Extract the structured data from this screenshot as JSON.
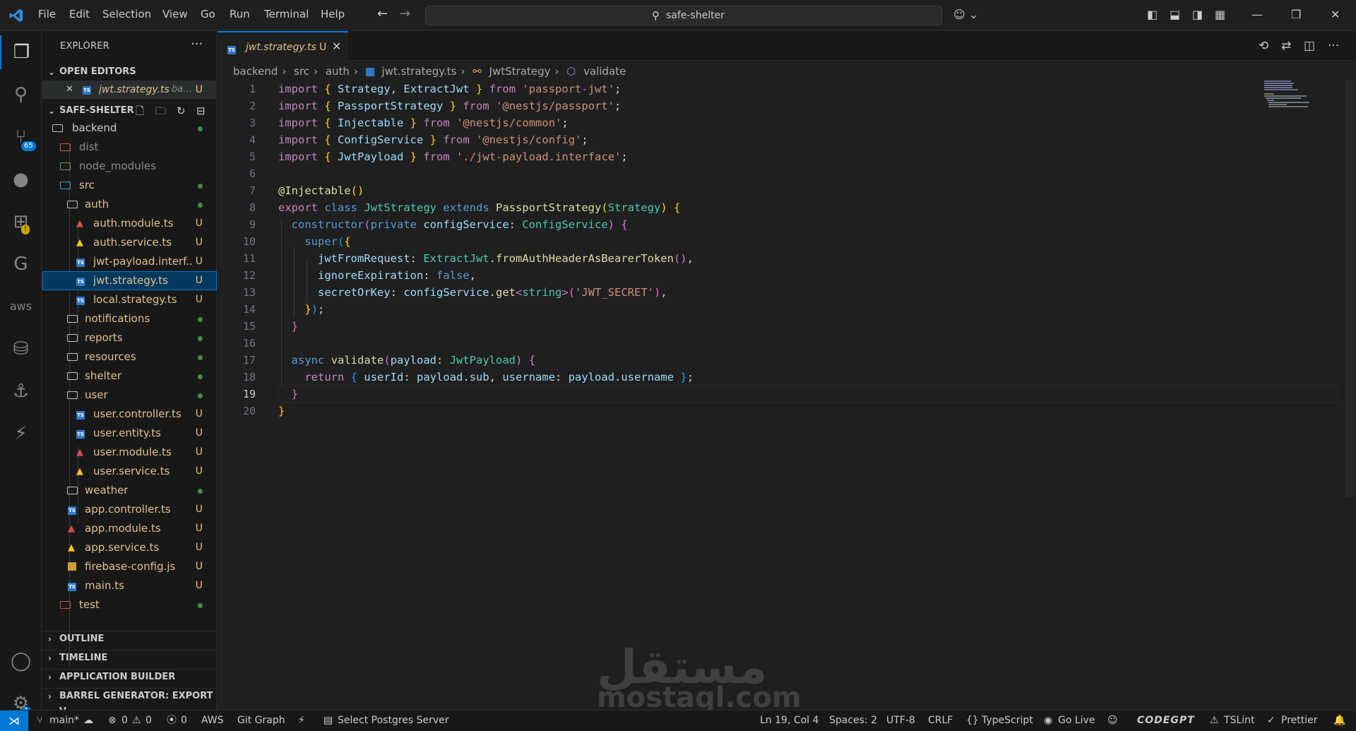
{
  "titlebar": {
    "menu": [
      "File",
      "Edit",
      "Selection",
      "View",
      "Go",
      "Run",
      "Terminal",
      "Help"
    ],
    "search_text": "safe-shelter"
  },
  "activity": {
    "scm_badge": "65",
    "accounts_badge": "1",
    "aws_label": "aws"
  },
  "sidebar": {
    "title": "EXPLORER",
    "open_editors_label": "OPEN EDITORS",
    "open_editor_file": "jwt.strategy.ts",
    "open_editor_dir": "ba...",
    "open_editor_status": "U",
    "project_label": "SAFE-SHELTER",
    "tree": [
      {
        "name": "backend",
        "status": "dot"
      },
      {
        "name": "dist",
        "status": ""
      },
      {
        "name": "node_modules",
        "status": ""
      },
      {
        "name": "src",
        "status": "dot"
      },
      {
        "name": "auth",
        "status": "dot"
      },
      {
        "name": "auth.module.ts",
        "status": "U"
      },
      {
        "name": "auth.service.ts",
        "status": "U"
      },
      {
        "name": "jwt-payload.interf...",
        "status": "U"
      },
      {
        "name": "jwt.strategy.ts",
        "status": "U"
      },
      {
        "name": "local.strategy.ts",
        "status": "U"
      },
      {
        "name": "notifications",
        "status": "dot"
      },
      {
        "name": "reports",
        "status": "dot"
      },
      {
        "name": "resources",
        "status": "dot"
      },
      {
        "name": "shelter",
        "status": "dot"
      },
      {
        "name": "user",
        "status": "dot"
      },
      {
        "name": "user.controller.ts",
        "status": "U"
      },
      {
        "name": "user.entity.ts",
        "status": "U"
      },
      {
        "name": "user.module.ts",
        "status": "U"
      },
      {
        "name": "user.service.ts",
        "status": "U"
      },
      {
        "name": "weather",
        "status": "dot"
      },
      {
        "name": "app.controller.ts",
        "status": "U"
      },
      {
        "name": "app.module.ts",
        "status": "U"
      },
      {
        "name": "app.service.ts",
        "status": "U"
      },
      {
        "name": "firebase-config.js",
        "status": "U"
      },
      {
        "name": "main.ts",
        "status": "U"
      },
      {
        "name": "test",
        "status": "dot"
      }
    ],
    "sections": [
      "OUTLINE",
      "TIMELINE",
      "APPLICATION BUILDER",
      "BARREL GENERATOR: EXPORT V..."
    ]
  },
  "tab": {
    "name": "jwt.strategy.ts",
    "status": "U",
    "icon_text": "TS"
  },
  "breadcrumb": [
    "backend",
    "src",
    "auth",
    "jwt.strategy.ts",
    "JwtStrategy",
    "validate"
  ],
  "editor": {
    "line_numbers": [
      "1",
      "2",
      "3",
      "4",
      "5",
      "6",
      "7",
      "8",
      "9",
      "10",
      "11",
      "12",
      "13",
      "14",
      "15",
      "16",
      "17",
      "18",
      "19",
      "20"
    ],
    "current_line": "19"
  },
  "watermark": {
    "arabic": "مستقل",
    "latin": "mostaql.com"
  },
  "statusbar": {
    "branch": "main*",
    "errors": "0",
    "warnings": "0",
    "ports": "0",
    "aws": "AWS",
    "git_graph": "Git Graph",
    "postgres": "Select Postgres Server",
    "position": "Ln 19, Col 4",
    "spaces": "Spaces: 2",
    "encoding": "UTF-8",
    "eol": "CRLF",
    "language": "TypeScript",
    "golive": "Go Live",
    "codegpt": "CODEGPT",
    "tslint": "TSLint",
    "prettier": "Prettier"
  },
  "colors": {
    "accent": "#0078d4",
    "modified": "#e2c08d",
    "background": "#1f1f1f"
  }
}
